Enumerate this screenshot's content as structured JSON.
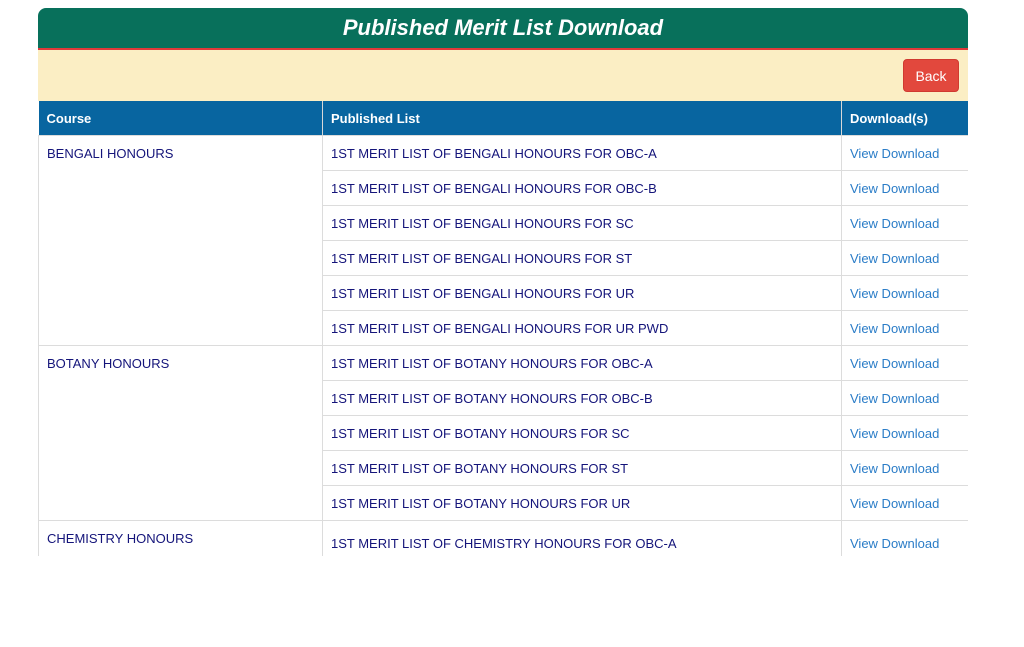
{
  "page": {
    "title": "Published Merit List Download",
    "back_label": "Back"
  },
  "table": {
    "headers": [
      "Course",
      "Published List",
      "Download(s)"
    ],
    "groups": [
      {
        "course": "BENGALI HONOURS",
        "lists": [
          "1ST MERIT LIST OF BENGALI HONOURS FOR OBC-A",
          "1ST MERIT LIST OF BENGALI HONOURS FOR OBC-B",
          "1ST MERIT LIST OF BENGALI HONOURS FOR SC",
          "1ST MERIT LIST OF BENGALI HONOURS FOR ST",
          "1ST MERIT LIST OF BENGALI HONOURS FOR UR",
          "1ST MERIT LIST OF BENGALI HONOURS FOR UR PWD"
        ]
      },
      {
        "course": "BOTANY HONOURS",
        "lists": [
          "1ST MERIT LIST OF BOTANY HONOURS FOR OBC-A",
          "1ST MERIT LIST OF BOTANY HONOURS FOR OBC-B",
          "1ST MERIT LIST OF BOTANY HONOURS FOR SC",
          "1ST MERIT LIST OF BOTANY HONOURS FOR ST",
          "1ST MERIT LIST OF BOTANY HONOURS FOR UR"
        ]
      },
      {
        "course": "CHEMISTRY HONOURS",
        "lists": [
          "1ST MERIT LIST OF CHEMISTRY HONOURS FOR OBC-A"
        ]
      }
    ],
    "download_label": "View Download"
  },
  "colors": {
    "title_bg": "#08705b",
    "title_border": "#e03a3a",
    "action_bar_bg": "#fbeec4",
    "back_button_bg": "#e2483d",
    "header_bg": "#0865a0",
    "cell_text": "#14147a",
    "link_text": "#2a7cc7"
  }
}
